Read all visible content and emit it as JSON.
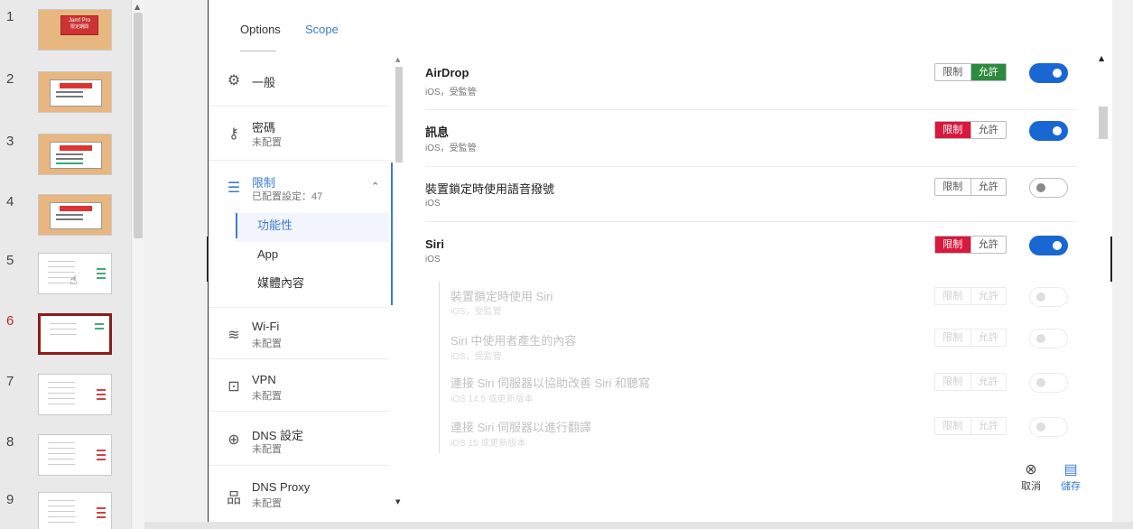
{
  "thumbnails": [
    {
      "num": "1",
      "style": "warm",
      "card_title": "Jamf Pro",
      "card_sub": "限定期間"
    },
    {
      "num": "2",
      "style": "warm"
    },
    {
      "num": "3",
      "style": "warm"
    },
    {
      "num": "4",
      "style": "warm"
    },
    {
      "num": "5",
      "style": "plain"
    },
    {
      "num": "6",
      "style": "selected"
    },
    {
      "num": "7",
      "style": "plain"
    },
    {
      "num": "8",
      "style": "plain"
    },
    {
      "num": "9",
      "style": "plain"
    }
  ],
  "tabs": {
    "options": "Options",
    "scope": "Scope"
  },
  "nav": {
    "general": {
      "title": "一般",
      "icon": "gear-icon"
    },
    "passcode": {
      "title": "密碼",
      "sub": "未配置",
      "icon": "key-icon"
    },
    "restrictions": {
      "title": "限制",
      "sub": "已配置設定：47",
      "icon": "list-icon"
    },
    "sub_items": [
      "功能性",
      "App",
      "媒體內容"
    ],
    "wifi": {
      "title": "Wi-Fi",
      "sub": "未配置",
      "icon": "wifi-icon"
    },
    "vpn": {
      "title": "VPN",
      "sub": "未配置",
      "icon": "lock-icon"
    },
    "dns": {
      "title": "DNS 設定",
      "sub": "未配置",
      "icon": "globe-icon"
    },
    "dns_proxy": {
      "title": "DNS Proxy",
      "sub": "未配置",
      "icon": "network-icon"
    }
  },
  "segment": {
    "restrict": "限制",
    "allow": "允許"
  },
  "rows": [
    {
      "title": "AirDrop",
      "sub": "iOS，受監管",
      "selected": "allow",
      "toggle": "on"
    },
    {
      "title": "訊息",
      "sub": "iOS，受監管",
      "selected": "restrict",
      "toggle": "on"
    },
    {
      "title": "裝置鎖定時使用語音撥號",
      "sub": "iOS",
      "selected": "none",
      "toggle": "off"
    },
    {
      "title": "Siri",
      "sub": "iOS",
      "selected": "restrict",
      "toggle": "on"
    },
    {
      "title": "裝置鎖定時使用 Siri",
      "sub": "iOS，受監管",
      "selected": "none",
      "toggle": "off"
    },
    {
      "title": "Siri 中使用者產生的內容",
      "sub": "iOS，受監管",
      "selected": "none",
      "toggle": "off"
    },
    {
      "title": "連接 Siri 伺服器以協助改善 Siri 和聽寫",
      "sub": "iOS 14.5 或更新版本",
      "selected": "none",
      "toggle": "off"
    },
    {
      "title": "連接 Siri 伺服器以進行翻譯",
      "sub": "iOS 15 或更新版本",
      "selected": "none",
      "toggle": "off"
    }
  ],
  "actions": {
    "cancel": "取消",
    "save": "儲存"
  },
  "colors": {
    "accent": "#3a7bd5",
    "restrict": "#d9183d",
    "allow": "#2b8a3e",
    "toggle_on": "#1967d2",
    "selected_slide": "#8b1c1c"
  }
}
